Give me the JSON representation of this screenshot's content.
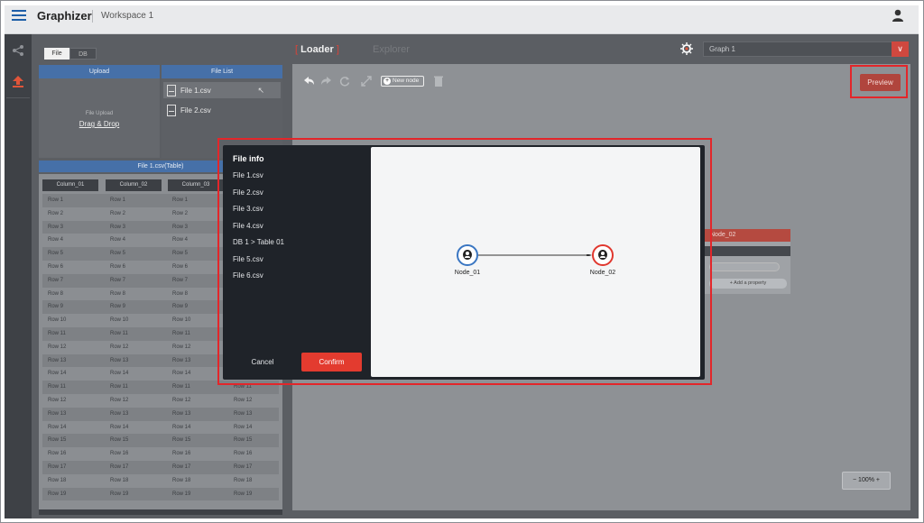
{
  "header": {
    "brand": "Graphizer",
    "workspace": "Workspace 1"
  },
  "sidebar": {
    "icons": [
      "share-icon",
      "upload-icon"
    ]
  },
  "source_toggle": {
    "options": [
      "File",
      "DB"
    ],
    "selected": "File"
  },
  "upload_panel": {
    "header": "Upload",
    "label": "File Upload",
    "drop_text": "Drag & Drop"
  },
  "file_list": {
    "header": "File List",
    "items": [
      "File 1.csv",
      "File 2.csv"
    ],
    "selected": "File 1.csv"
  },
  "table": {
    "title": "File 1.csv(Table)",
    "columns": [
      "Column_01",
      "Column_02",
      "Column_03"
    ],
    "rows": [
      [
        "Row 1",
        "Row 1",
        "Row 1",
        ""
      ],
      [
        "Row 2",
        "Row 2",
        "Row 2",
        ""
      ],
      [
        "Row 3",
        "Row 3",
        "Row 3",
        ""
      ],
      [
        "Row 4",
        "Row 4",
        "Row 4",
        ""
      ],
      [
        "Row 5",
        "Row 5",
        "Row 5",
        ""
      ],
      [
        "Row 6",
        "Row 6",
        "Row 6",
        ""
      ],
      [
        "Row 7",
        "Row 7",
        "Row 7",
        ""
      ],
      [
        "Row 8",
        "Row 8",
        "Row 8",
        ""
      ],
      [
        "Row 9",
        "Row 9",
        "Row 9",
        ""
      ],
      [
        "Row 10",
        "Row 10",
        "Row 10",
        ""
      ],
      [
        "Row 11",
        "Row 11",
        "Row 11",
        ""
      ],
      [
        "Row 12",
        "Row 12",
        "Row 12",
        ""
      ],
      [
        "Row 13",
        "Row 13",
        "Row 13",
        ""
      ],
      [
        "Row 14",
        "Row 14",
        "Row 14",
        ""
      ],
      [
        "Row 11",
        "Row 11",
        "Row 11",
        "Row 11"
      ],
      [
        "Row 12",
        "Row 12",
        "Row 12",
        "Row 12"
      ],
      [
        "Row 13",
        "Row 13",
        "Row 13",
        "Row 13"
      ],
      [
        "Row 14",
        "Row 14",
        "Row 14",
        "Row 14"
      ],
      [
        "Row 15",
        "Row 15",
        "Row 15",
        "Row 15"
      ],
      [
        "Row 16",
        "Row 16",
        "Row 16",
        "Row 16"
      ],
      [
        "Row 17",
        "Row 17",
        "Row 17",
        "Row 17"
      ],
      [
        "Row 18",
        "Row 18",
        "Row 18",
        "Row 18"
      ],
      [
        "Row 19",
        "Row 19",
        "Row 19",
        "Row 19"
      ]
    ]
  },
  "tabs": [
    {
      "label": "Loader",
      "active": true
    },
    {
      "label": "Explorer",
      "active": false
    }
  ],
  "graph_select": {
    "value": "Graph 1"
  },
  "toolbar": {
    "new_node_label": "New node",
    "preview_label": "Preview"
  },
  "node_card": {
    "title": "Node_02",
    "add_property_label": "+ Add a property"
  },
  "zoom": {
    "label": "−  100%  +"
  },
  "modal": {
    "sidebar_title": "File info",
    "items": [
      "File 1.csv",
      "File 2.csv",
      "File 3.csv",
      "File 4.csv",
      "DB 1 > Table 01",
      "File 5.csv",
      "File 6.csv"
    ],
    "cancel_label": "Cancel",
    "confirm_label": "Confirm",
    "graph": {
      "nodes": [
        "Node_01",
        "Node_02"
      ]
    }
  },
  "colors": {
    "accent_red": "#e33b2f",
    "accent_blue": "#4670a8",
    "node_blue": "#3a76c2",
    "node_red": "#e0372e"
  }
}
